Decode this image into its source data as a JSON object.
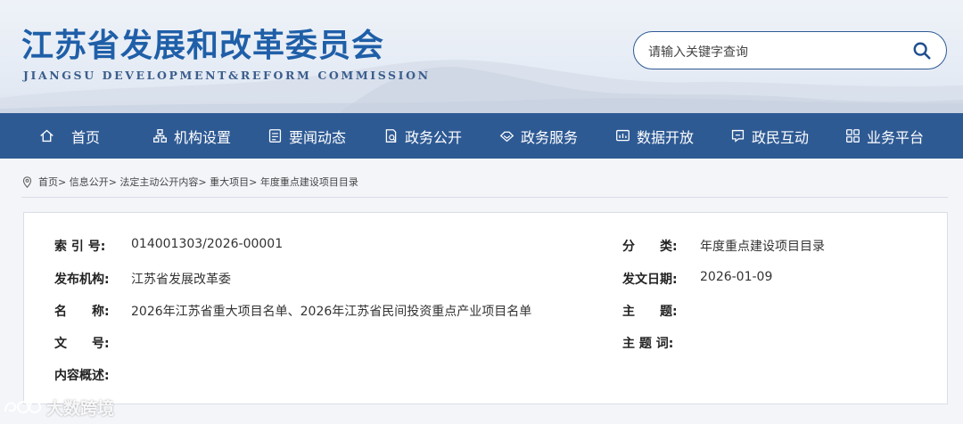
{
  "header": {
    "title_cn": "江苏省发展和改革委员会",
    "title_en": "JIANGSU DEVELOPMENT&REFORM COMMISSION",
    "search_placeholder": "请输入关键字查询"
  },
  "nav": {
    "items": [
      {
        "label": "首页",
        "icon": "home-icon"
      },
      {
        "label": "机构设置",
        "icon": "org-icon"
      },
      {
        "label": "要闻动态",
        "icon": "news-icon"
      },
      {
        "label": "政务公开",
        "icon": "doc-icon"
      },
      {
        "label": "政务服务",
        "icon": "service-icon"
      },
      {
        "label": "数据开放",
        "icon": "data-icon"
      },
      {
        "label": "政民互动",
        "icon": "chat-icon"
      },
      {
        "label": "业务平台",
        "icon": "grid-icon"
      }
    ]
  },
  "breadcrumb": {
    "text": "首页> 信息公开> 法定主动公开内容> 重大项目> 年度重点建设项目目录"
  },
  "info": {
    "index_label": "索 引 号:",
    "index_value": "014001303/2026-00001",
    "category_label": "分　　类:",
    "category_value": "年度重点建设项目目录",
    "publisher_label": "发布机构:",
    "publisher_value": "江苏省发展改革委",
    "date_label": "发文日期:",
    "date_value": "2026-01-09",
    "name_label": "名　　称:",
    "name_value": "2026年江苏省重大项目名单、2026年江苏省民间投资重点产业项目名单",
    "subject_label": "主　　题:",
    "subject_value": "",
    "docno_label": "文　　号:",
    "docno_value": "",
    "keyword_label": "主 题 词:",
    "keyword_value": "",
    "summary_label": "内容概述:",
    "summary_value": ""
  },
  "watermark": {
    "text": "大数跨境"
  }
}
